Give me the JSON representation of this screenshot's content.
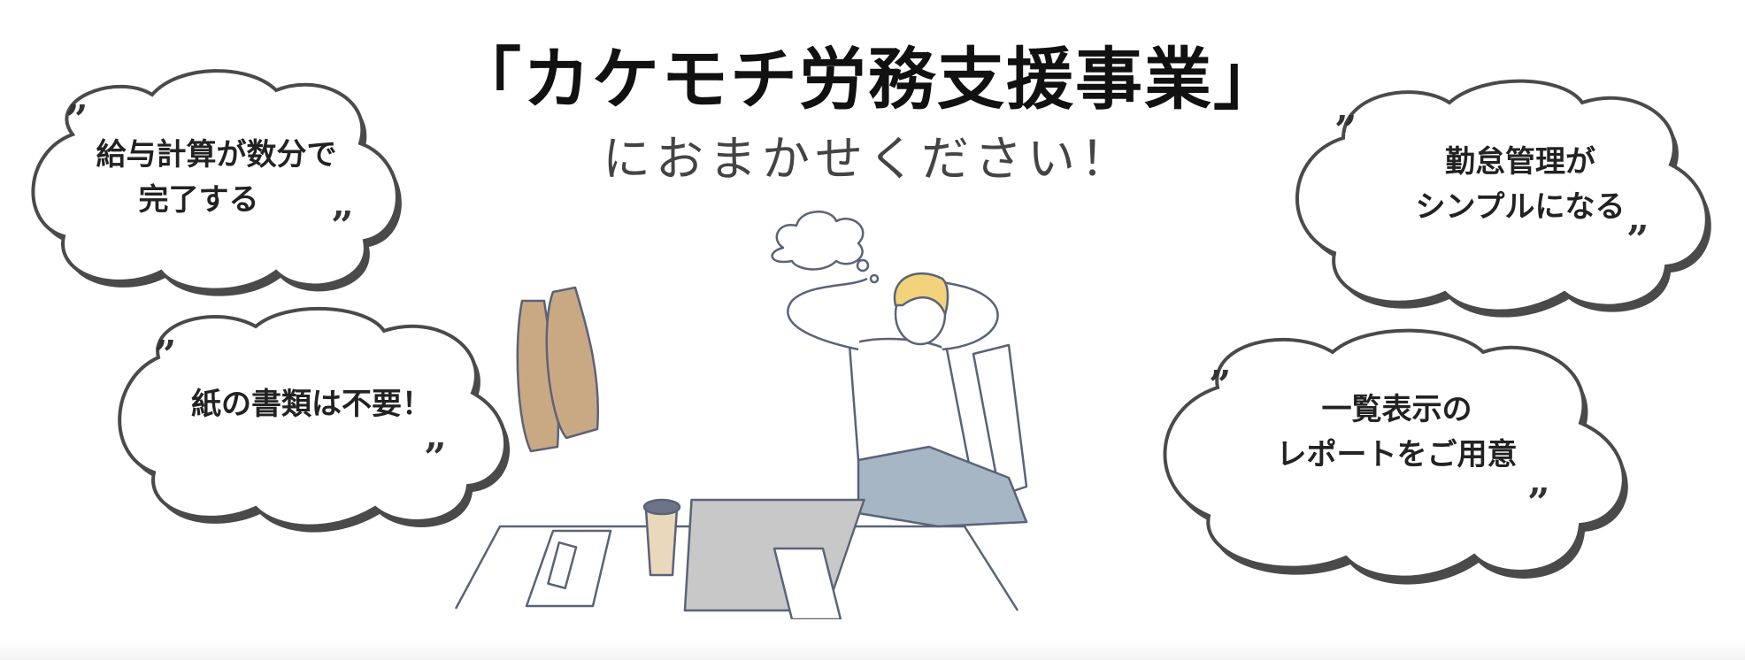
{
  "header": {
    "title": "「カケモチ労務支援事業」",
    "subtitle": "におまかせください！"
  },
  "bubbles": [
    {
      "lines": [
        "給与計算が数分で",
        "完了する"
      ]
    },
    {
      "lines": [
        "紙の書類は不要！"
      ]
    },
    {
      "lines": [
        "勤怠管理が",
        "シンプルになる"
      ]
    },
    {
      "lines": [
        "一覧表示の",
        "レポートをご用意"
      ]
    }
  ],
  "quote_mark": "”",
  "colors": {
    "outline": "#4a4a4a",
    "illustration_line": "#5a6378",
    "shoe": "#c9a984",
    "jeans": "#a7b6c4",
    "laptop": "#c8c8c8",
    "hair": "#f2d27a"
  }
}
